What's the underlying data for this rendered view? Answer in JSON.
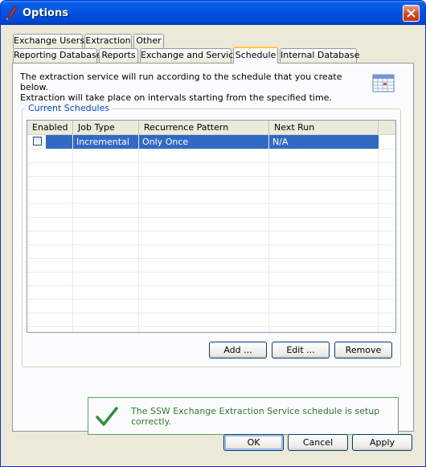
{
  "window": {
    "title": "Options",
    "close_label": "Close"
  },
  "tabs": {
    "row1": [
      "Exchange Users",
      "Extraction",
      "Other"
    ],
    "row2": [
      "Reporting Database",
      "Reports",
      "Exchange and Service",
      "Schedule",
      "Internal Database"
    ],
    "active": "Schedule"
  },
  "intro": {
    "line1": "The extraction service will run according to the schedule that you create below.",
    "line2": "Extraction will take place on intervals starting from the specified time."
  },
  "schedules": {
    "group_label": "Current Schedules",
    "columns": [
      "Enabled",
      "Job Type",
      "Recurrence Pattern",
      "Next Run"
    ],
    "rows": [
      {
        "enabled": false,
        "job_type": "Incremental",
        "recurrence": "Only Once",
        "next_run": "N/A"
      }
    ]
  },
  "grid_buttons": {
    "add": "Add ...",
    "edit": "Edit ...",
    "remove": "Remove"
  },
  "status": {
    "message": "The SSW Exchange Extraction Service schedule is setup correctly.",
    "color": "#2b7a2b"
  },
  "footer": {
    "ok": "OK",
    "cancel": "Cancel",
    "apply": "Apply"
  },
  "colors": {
    "selection": "#316ac5",
    "title_bar": "#0054e3",
    "accent_tab": "#ffc83c"
  }
}
